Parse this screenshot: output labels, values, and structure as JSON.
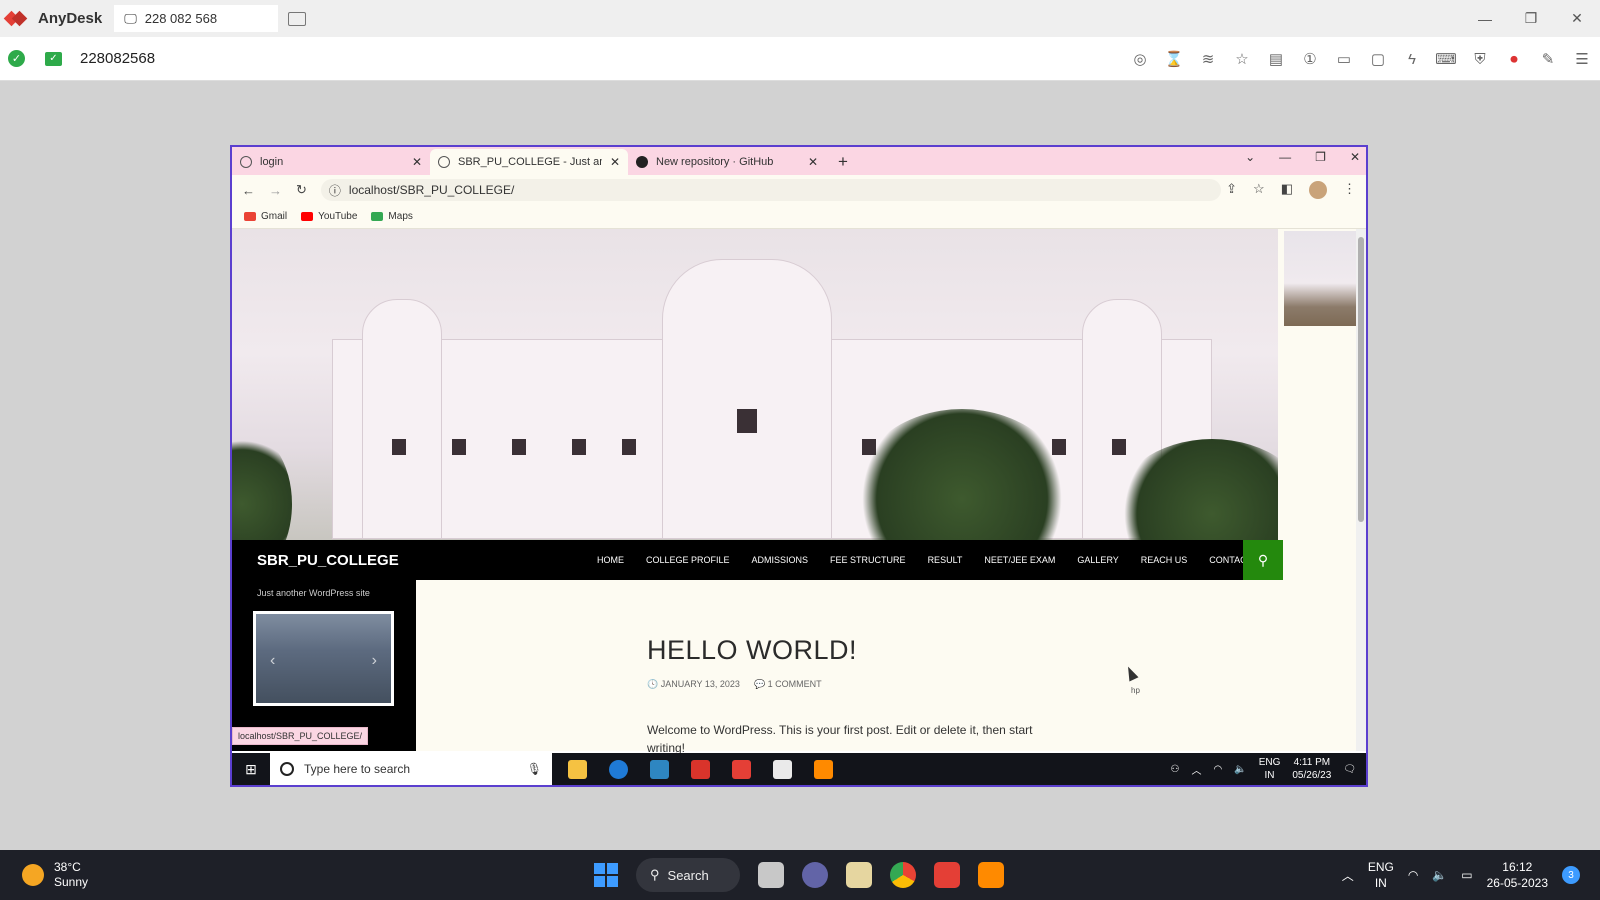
{
  "anydesk": {
    "app_name": "AnyDesk",
    "session_tab": "228 082 568",
    "connected_id": "228082568"
  },
  "browser": {
    "tabs": [
      {
        "title": "login"
      },
      {
        "title": "SBR_PU_COLLEGE - Just another"
      },
      {
        "title": "New repository · GitHub"
      }
    ],
    "address": "localhost/SBR_PU_COLLEGE/",
    "bookmarks": [
      {
        "label": "Gmail",
        "color": "#ea4335"
      },
      {
        "label": "YouTube",
        "color": "#ff0000"
      },
      {
        "label": "Maps",
        "color": "#34a853"
      }
    ],
    "status_url": "localhost/SBR_PU_COLLEGE/"
  },
  "site": {
    "title": "SBR_PU_COLLEGE",
    "tagline": "Just another WordPress site",
    "menu": [
      "HOME",
      "COLLEGE PROFILE",
      "ADMISSIONS",
      "FEE STRUCTURE",
      "RESULT",
      "NEET/JEE EXAM",
      "GALLERY",
      "REACH US",
      "CONTACT"
    ],
    "accent_color": "#24890d",
    "post": {
      "title": "HELLO WORLD!",
      "date": "JANUARY 13, 2023",
      "comments": "1 COMMENT",
      "excerpt": "Welcome to WordPress. This is your first post. Edit or delete it, then start writing!"
    },
    "cursor_label": "hp"
  },
  "remote_taskbar": {
    "search_placeholder": "Type here to search",
    "lang_line1": "ENG",
    "lang_line2": "IN",
    "time": "4:11 PM",
    "date": "05/26/23"
  },
  "host_taskbar": {
    "temperature": "38°C",
    "weather": "Sunny",
    "search_label": "Search",
    "lang_line1": "ENG",
    "lang_line2": "IN",
    "time": "16:12",
    "date": "26-05-2023",
    "notification_count": "3"
  }
}
